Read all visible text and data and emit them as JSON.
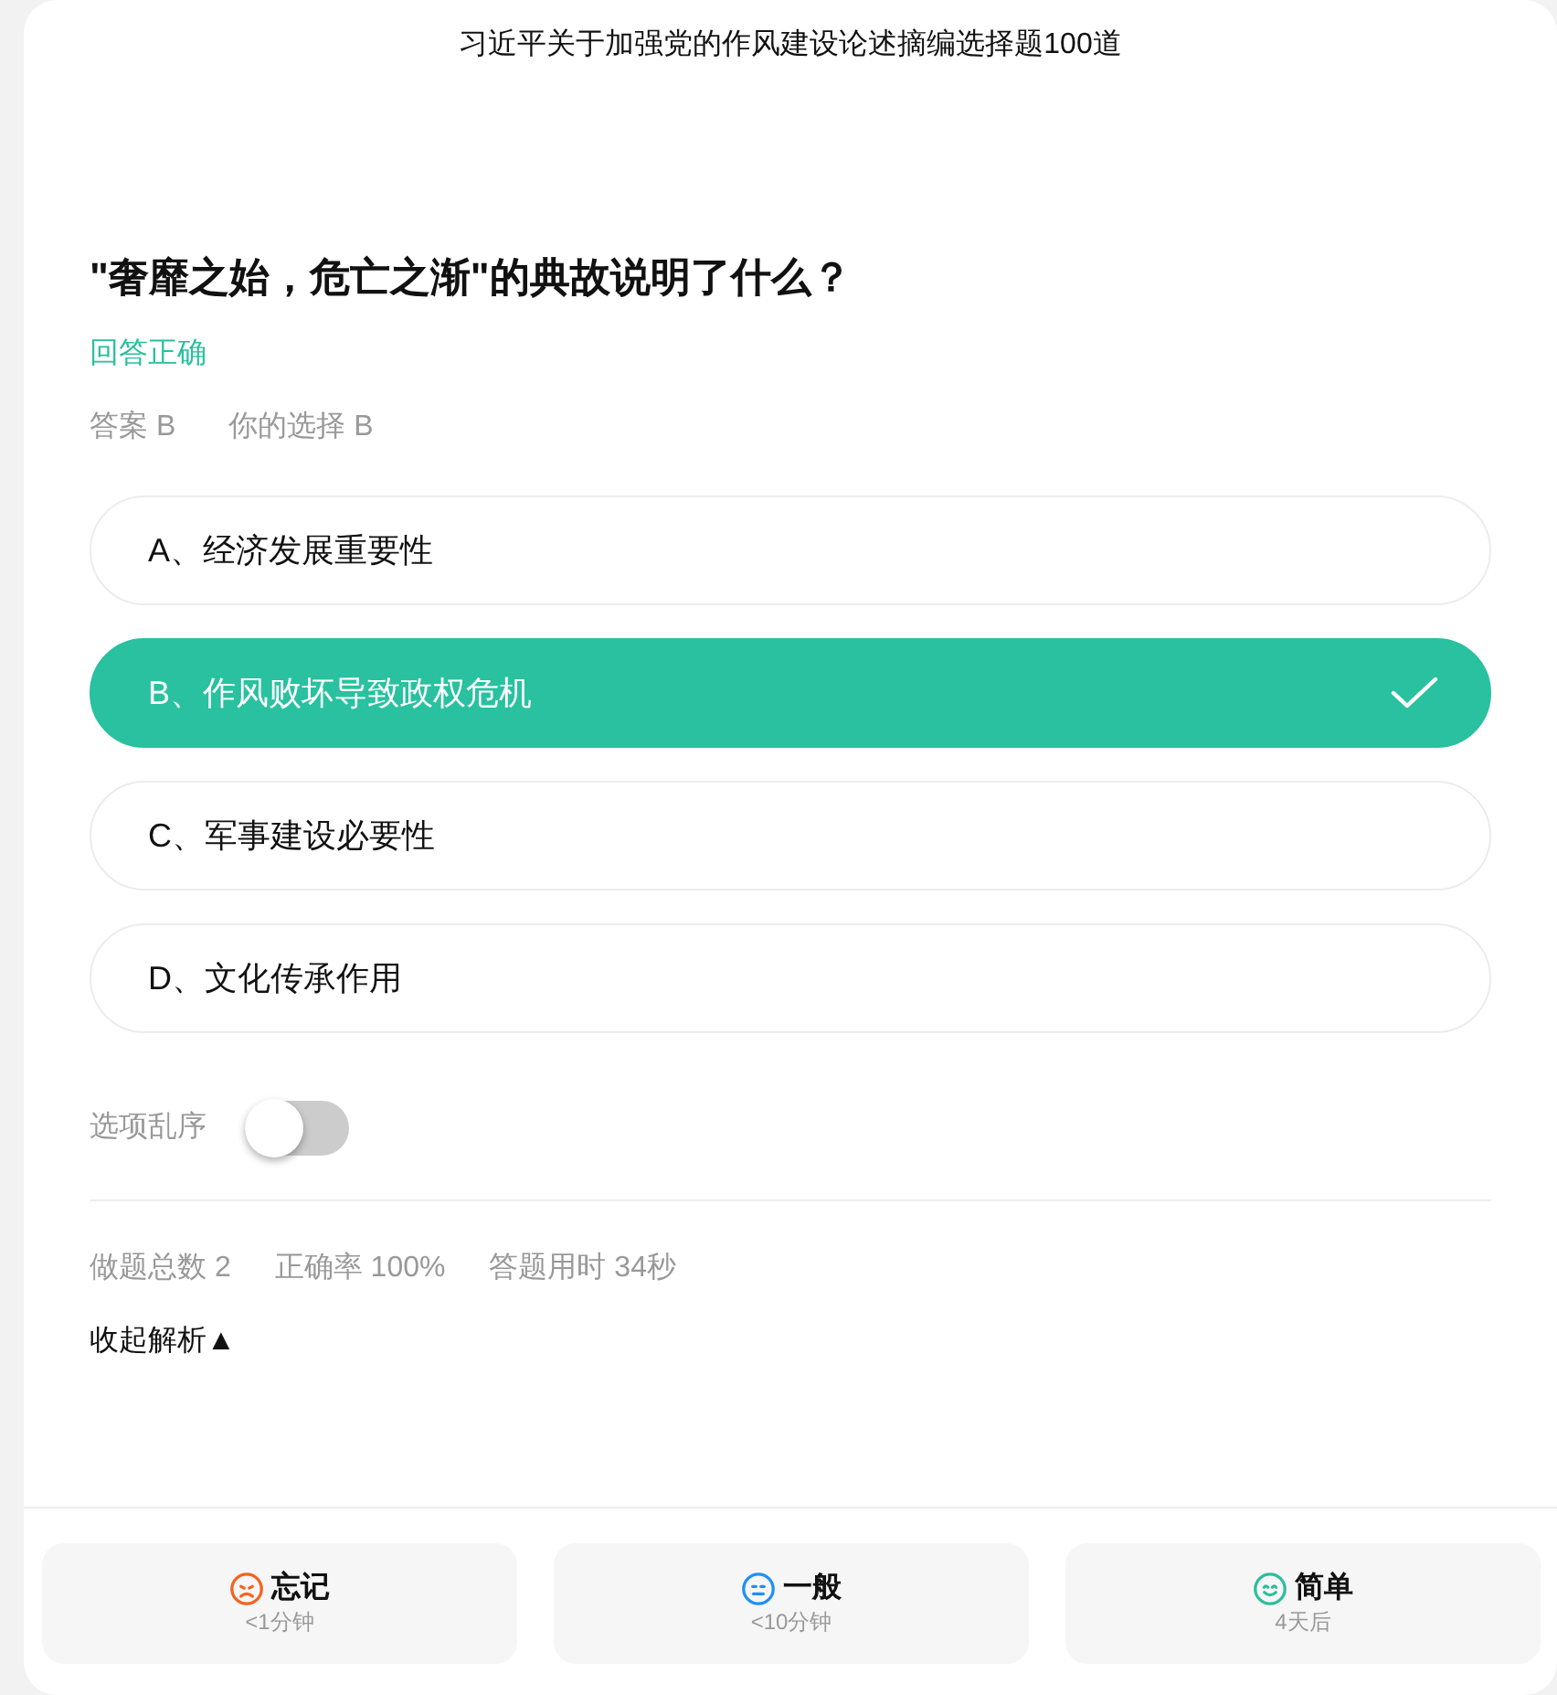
{
  "header": {
    "title": "习近平关于加强党的作风建设论述摘编选择题100道"
  },
  "question": {
    "text": "\"奢靡之始，危亡之渐\"的典故说明了什么？",
    "result": "回答正确",
    "correct": true,
    "answer": "答案 B",
    "choice": "你的选择 B"
  },
  "options": [
    {
      "label": "A、经济发展重要性",
      "selected": false
    },
    {
      "label": "B、作风败坏导致政权危机",
      "selected": true
    },
    {
      "label": "C、军事建设必要性",
      "selected": false
    },
    {
      "label": "D、文化传承作用",
      "selected": false
    }
  ],
  "shuffle": {
    "label": "选项乱序",
    "on": false
  },
  "stats": [
    "做题总数 2",
    "正确率 100%",
    "答题用时 34秒"
  ],
  "analysis_toggle": "收起解析▲",
  "ratings": [
    {
      "kind": "sad",
      "label": "忘记",
      "interval": "<1分钟",
      "color": "#f5621e"
    },
    {
      "kind": "neutral",
      "label": "一般",
      "interval": "<10分钟",
      "color": "#1e90f5"
    },
    {
      "kind": "happy",
      "label": "简单",
      "interval": "4天后",
      "color": "#2bbf9d"
    }
  ]
}
